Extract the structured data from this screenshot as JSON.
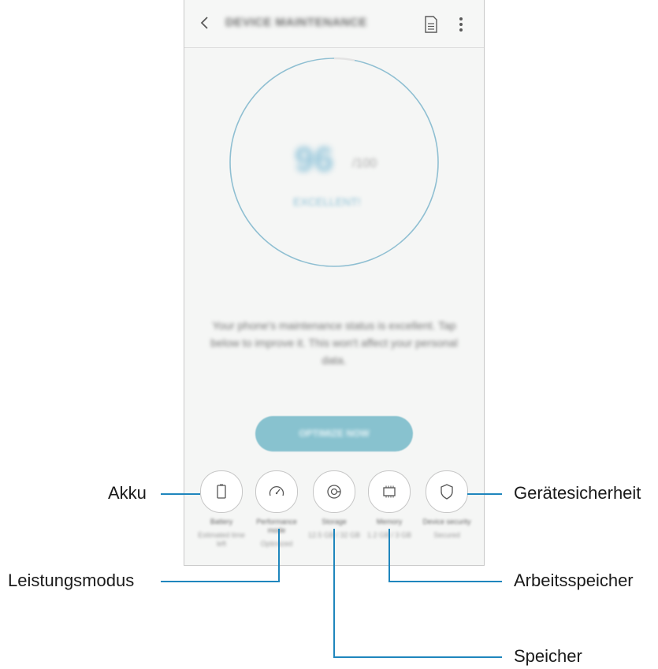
{
  "appbar": {
    "title": "DEVICE MAINTENANCE",
    "back_icon": "chevron-left-icon",
    "report_icon": "document-icon",
    "menu_icon": "more-vertical-icon"
  },
  "status": {
    "score": "96",
    "score_unit": "/100",
    "label": "EXCELLENT!"
  },
  "description": "Your phone's maintenance status is excellent. Tap below to improve it. This won't affect your personal data.",
  "optimize_label": "OPTIMIZE NOW",
  "tiles": [
    {
      "label": "Battery",
      "value": "Estimated time left",
      "icon": "battery-icon"
    },
    {
      "label": "Performance mode",
      "value": "Optimized",
      "icon": "speedometer-icon"
    },
    {
      "label": "Storage",
      "value": "12.5 GB / 32 GB",
      "icon": "storage-icon"
    },
    {
      "label": "Memory",
      "value": "1.2 GB / 3 GB",
      "icon": "chip-icon"
    },
    {
      "label": "Device security",
      "value": "Secured",
      "icon": "shield-icon"
    }
  ],
  "callouts": {
    "akku": "Akku",
    "leistungsmodus": "Leistungsmodus",
    "speicher": "Speicher",
    "geraetesicherheit": "Gerätesicherheit",
    "arbeitsspeicher": "Arbeitsspeicher"
  },
  "colors": {
    "accent": "#88c2cf",
    "ring": "#8fbfd2",
    "callout_line": "#1f86bd"
  }
}
